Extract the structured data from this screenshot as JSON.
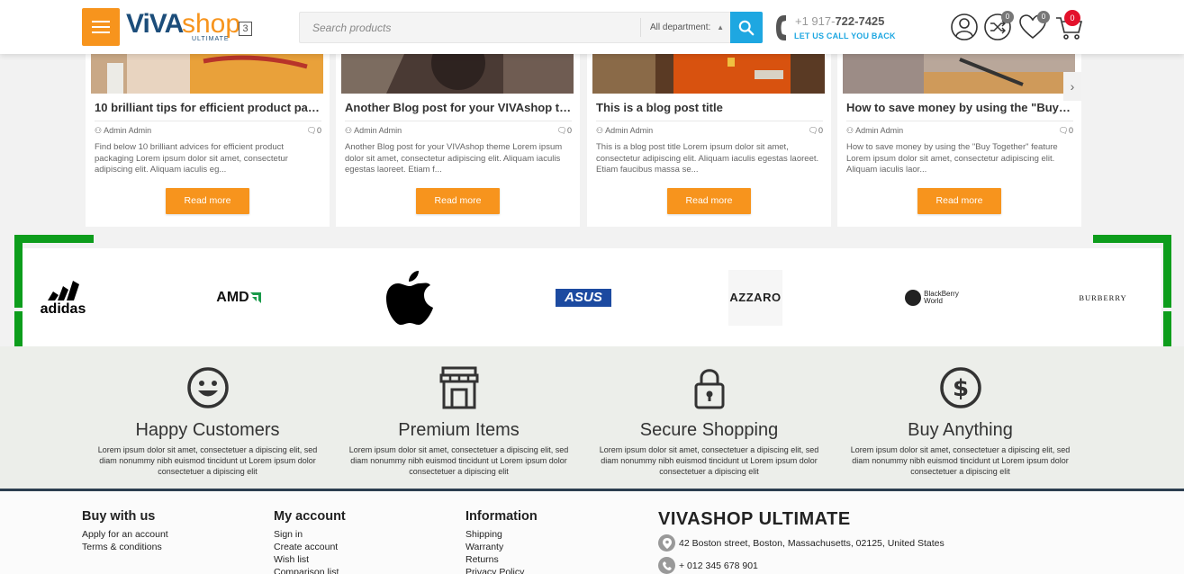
{
  "header": {
    "logo_main": "ViVA",
    "logo_shop": "shop",
    "logo_sub": "ULTIMATE",
    "logo_version": "3",
    "search_placeholder": "Search products",
    "department": "All department:",
    "phone_prefix": "+1 917-",
    "phone_main": "722-7425",
    "callback": "LET US CALL YOU BACK",
    "compare_count": "0",
    "wishlist_count": "0",
    "cart_count": "0"
  },
  "blog": [
    {
      "title": "10 brilliant tips for efficient product pac...",
      "author": "Admin Admin",
      "comments": "0",
      "desc": "Find below 10 brilliant advices for efficient product packaging Lorem ipsum dolor sit amet, consectetur adipiscing elit. Aliquam iaculis eg...",
      "button": "Read more"
    },
    {
      "title": "Another Blog post for your VIVAshop the...",
      "author": "Admin Admin",
      "comments": "0",
      "desc": "Another Blog post for your VIVAshop theme Lorem ipsum dolor sit amet, consectetur adipiscing elit. Aliquam iaculis egestas laoreet. Etiam f...",
      "button": "Read more"
    },
    {
      "title": "This is a blog post title",
      "author": "Admin Admin",
      "comments": "0",
      "desc": "This is a blog post title Lorem ipsum dolor sit amet, consectetur adipiscing elit. Aliquam iaculis egestas laoreet. Etiam faucibus massa se...",
      "button": "Read more"
    },
    {
      "title": "How to save money by using the \"Buy To...",
      "author": "Admin Admin",
      "comments": "0",
      "desc": "How to save money by using the \"Buy Together\" feature Lorem ipsum dolor sit amet, consectetur adipiscing elit. Aliquam iaculis laor...",
      "button": "Read more"
    }
  ],
  "brands": {
    "adidas": "adidas",
    "amd": "AMD",
    "asus": "ASUS",
    "azzaro": "AZZARO",
    "blackberry_1": "BlackBerry",
    "blackberry_2": "World",
    "burberry": "BURBERRY"
  },
  "features": [
    {
      "title": "Happy Customers",
      "desc": "Lorem ipsum dolor sit amet, consectetuer a dipiscing elit, sed diam nonummy nibh euismod tincidunt ut Lorem ipsum dolor consectetuer a dipiscing elit"
    },
    {
      "title": "Premium Items",
      "desc": "Lorem ipsum dolor sit amet, consectetuer a dipiscing elit, sed diam nonummy nibh euismod tincidunt ut Lorem ipsum dolor consectetuer a dipiscing elit"
    },
    {
      "title": "Secure Shopping",
      "desc": "Lorem ipsum dolor sit amet, consectetuer a dipiscing elit, sed diam nonummy nibh euismod tincidunt ut Lorem ipsum dolor consectetuer a dipiscing elit"
    },
    {
      "title": "Buy Anything",
      "desc": "Lorem ipsum dolor sit amet, consectetuer a dipiscing elit, sed diam nonummy nibh euismod tincidunt ut Lorem ipsum dolor consectetuer a dipiscing elit"
    }
  ],
  "footer": {
    "col1": {
      "title": "Buy with us",
      "links": [
        "Apply for an account",
        "Terms & conditions"
      ]
    },
    "col2": {
      "title": "My account",
      "links": [
        "Sign in",
        "Create account",
        "Wish list",
        "Comparison list"
      ]
    },
    "col3": {
      "title": "Information",
      "links": [
        "Shipping",
        "Warranty",
        "Returns",
        "Privacy Policy"
      ]
    },
    "company": "VIVASHOP ULTIMATE",
    "address": "42 Boston street, Boston, Massachusetts, 02125, United States",
    "phone": "+ 012 345 678 901"
  },
  "colors": {
    "accent": "#f7941d",
    "blue": "#1ea7e1",
    "bracket": "#0d9d1c"
  }
}
